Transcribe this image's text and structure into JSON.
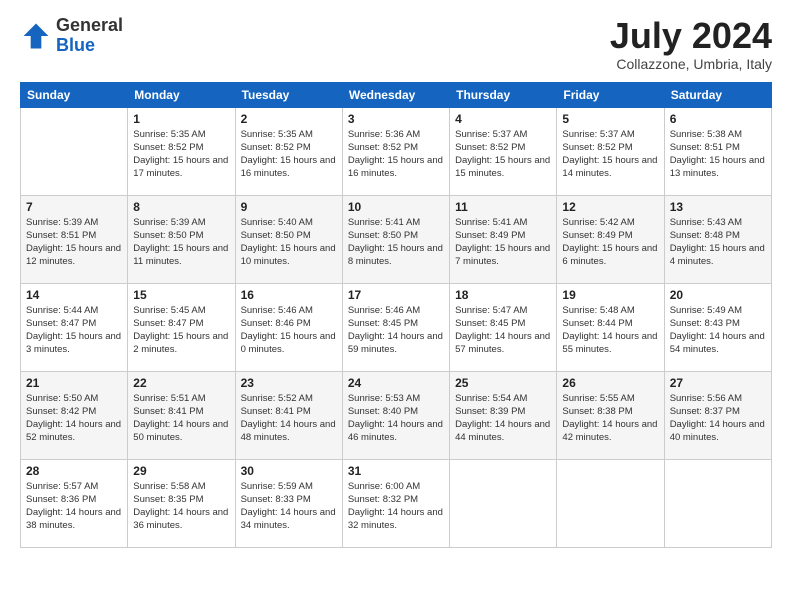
{
  "logo": {
    "general": "General",
    "blue": "Blue"
  },
  "title": "July 2024",
  "subtitle": "Collazzone, Umbria, Italy",
  "weekdays": [
    "Sunday",
    "Monday",
    "Tuesday",
    "Wednesday",
    "Thursday",
    "Friday",
    "Saturday"
  ],
  "weeks": [
    [
      {
        "day": "",
        "sunrise": "",
        "sunset": "",
        "daylight": ""
      },
      {
        "day": "1",
        "sunrise": "Sunrise: 5:35 AM",
        "sunset": "Sunset: 8:52 PM",
        "daylight": "Daylight: 15 hours and 17 minutes."
      },
      {
        "day": "2",
        "sunrise": "Sunrise: 5:35 AM",
        "sunset": "Sunset: 8:52 PM",
        "daylight": "Daylight: 15 hours and 16 minutes."
      },
      {
        "day": "3",
        "sunrise": "Sunrise: 5:36 AM",
        "sunset": "Sunset: 8:52 PM",
        "daylight": "Daylight: 15 hours and 16 minutes."
      },
      {
        "day": "4",
        "sunrise": "Sunrise: 5:37 AM",
        "sunset": "Sunset: 8:52 PM",
        "daylight": "Daylight: 15 hours and 15 minutes."
      },
      {
        "day": "5",
        "sunrise": "Sunrise: 5:37 AM",
        "sunset": "Sunset: 8:52 PM",
        "daylight": "Daylight: 15 hours and 14 minutes."
      },
      {
        "day": "6",
        "sunrise": "Sunrise: 5:38 AM",
        "sunset": "Sunset: 8:51 PM",
        "daylight": "Daylight: 15 hours and 13 minutes."
      }
    ],
    [
      {
        "day": "7",
        "sunrise": "Sunrise: 5:39 AM",
        "sunset": "Sunset: 8:51 PM",
        "daylight": "Daylight: 15 hours and 12 minutes."
      },
      {
        "day": "8",
        "sunrise": "Sunrise: 5:39 AM",
        "sunset": "Sunset: 8:50 PM",
        "daylight": "Daylight: 15 hours and 11 minutes."
      },
      {
        "day": "9",
        "sunrise": "Sunrise: 5:40 AM",
        "sunset": "Sunset: 8:50 PM",
        "daylight": "Daylight: 15 hours and 10 minutes."
      },
      {
        "day": "10",
        "sunrise": "Sunrise: 5:41 AM",
        "sunset": "Sunset: 8:50 PM",
        "daylight": "Daylight: 15 hours and 8 minutes."
      },
      {
        "day": "11",
        "sunrise": "Sunrise: 5:41 AM",
        "sunset": "Sunset: 8:49 PM",
        "daylight": "Daylight: 15 hours and 7 minutes."
      },
      {
        "day": "12",
        "sunrise": "Sunrise: 5:42 AM",
        "sunset": "Sunset: 8:49 PM",
        "daylight": "Daylight: 15 hours and 6 minutes."
      },
      {
        "day": "13",
        "sunrise": "Sunrise: 5:43 AM",
        "sunset": "Sunset: 8:48 PM",
        "daylight": "Daylight: 15 hours and 4 minutes."
      }
    ],
    [
      {
        "day": "14",
        "sunrise": "Sunrise: 5:44 AM",
        "sunset": "Sunset: 8:47 PM",
        "daylight": "Daylight: 15 hours and 3 minutes."
      },
      {
        "day": "15",
        "sunrise": "Sunrise: 5:45 AM",
        "sunset": "Sunset: 8:47 PM",
        "daylight": "Daylight: 15 hours and 2 minutes."
      },
      {
        "day": "16",
        "sunrise": "Sunrise: 5:46 AM",
        "sunset": "Sunset: 8:46 PM",
        "daylight": "Daylight: 15 hours and 0 minutes."
      },
      {
        "day": "17",
        "sunrise": "Sunrise: 5:46 AM",
        "sunset": "Sunset: 8:45 PM",
        "daylight": "Daylight: 14 hours and 59 minutes."
      },
      {
        "day": "18",
        "sunrise": "Sunrise: 5:47 AM",
        "sunset": "Sunset: 8:45 PM",
        "daylight": "Daylight: 14 hours and 57 minutes."
      },
      {
        "day": "19",
        "sunrise": "Sunrise: 5:48 AM",
        "sunset": "Sunset: 8:44 PM",
        "daylight": "Daylight: 14 hours and 55 minutes."
      },
      {
        "day": "20",
        "sunrise": "Sunrise: 5:49 AM",
        "sunset": "Sunset: 8:43 PM",
        "daylight": "Daylight: 14 hours and 54 minutes."
      }
    ],
    [
      {
        "day": "21",
        "sunrise": "Sunrise: 5:50 AM",
        "sunset": "Sunset: 8:42 PM",
        "daylight": "Daylight: 14 hours and 52 minutes."
      },
      {
        "day": "22",
        "sunrise": "Sunrise: 5:51 AM",
        "sunset": "Sunset: 8:41 PM",
        "daylight": "Daylight: 14 hours and 50 minutes."
      },
      {
        "day": "23",
        "sunrise": "Sunrise: 5:52 AM",
        "sunset": "Sunset: 8:41 PM",
        "daylight": "Daylight: 14 hours and 48 minutes."
      },
      {
        "day": "24",
        "sunrise": "Sunrise: 5:53 AM",
        "sunset": "Sunset: 8:40 PM",
        "daylight": "Daylight: 14 hours and 46 minutes."
      },
      {
        "day": "25",
        "sunrise": "Sunrise: 5:54 AM",
        "sunset": "Sunset: 8:39 PM",
        "daylight": "Daylight: 14 hours and 44 minutes."
      },
      {
        "day": "26",
        "sunrise": "Sunrise: 5:55 AM",
        "sunset": "Sunset: 8:38 PM",
        "daylight": "Daylight: 14 hours and 42 minutes."
      },
      {
        "day": "27",
        "sunrise": "Sunrise: 5:56 AM",
        "sunset": "Sunset: 8:37 PM",
        "daylight": "Daylight: 14 hours and 40 minutes."
      }
    ],
    [
      {
        "day": "28",
        "sunrise": "Sunrise: 5:57 AM",
        "sunset": "Sunset: 8:36 PM",
        "daylight": "Daylight: 14 hours and 38 minutes."
      },
      {
        "day": "29",
        "sunrise": "Sunrise: 5:58 AM",
        "sunset": "Sunset: 8:35 PM",
        "daylight": "Daylight: 14 hours and 36 minutes."
      },
      {
        "day": "30",
        "sunrise": "Sunrise: 5:59 AM",
        "sunset": "Sunset: 8:33 PM",
        "daylight": "Daylight: 14 hours and 34 minutes."
      },
      {
        "day": "31",
        "sunrise": "Sunrise: 6:00 AM",
        "sunset": "Sunset: 8:32 PM",
        "daylight": "Daylight: 14 hours and 32 minutes."
      },
      {
        "day": "",
        "sunrise": "",
        "sunset": "",
        "daylight": ""
      },
      {
        "day": "",
        "sunrise": "",
        "sunset": "",
        "daylight": ""
      },
      {
        "day": "",
        "sunrise": "",
        "sunset": "",
        "daylight": ""
      }
    ]
  ]
}
